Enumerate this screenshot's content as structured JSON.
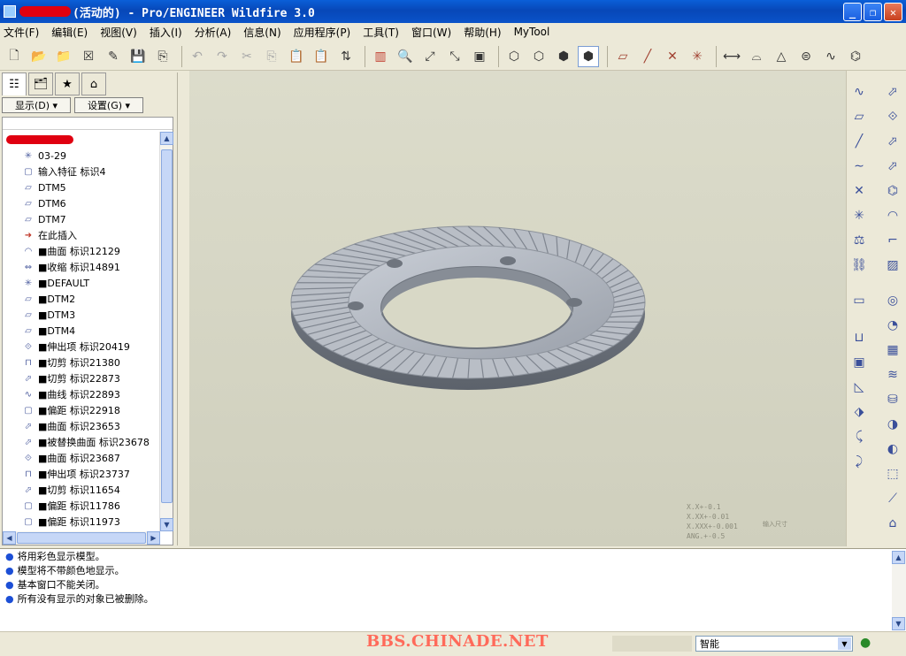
{
  "window": {
    "title": "(活动的) - Pro/ENGINEER Wildfire 3.0",
    "buttons": [
      "_",
      "❐",
      "✕"
    ]
  },
  "menu": [
    "文件(F)",
    "编辑(E)",
    "视图(V)",
    "插入(I)",
    "分析(A)",
    "信息(N)",
    "应用程序(P)",
    "工具(T)",
    "窗口(W)",
    "帮助(H)",
    "MyTool"
  ],
  "left_panel": {
    "display_button": "显示(D) ▾",
    "settings_button": "设置(G) ▾",
    "tree_items": [
      {
        "icon": "csys-icon",
        "glyph": "✳",
        "label": "03-29"
      },
      {
        "icon": "import-feature-icon",
        "glyph": "▢",
        "label": "输入特征 标识4"
      },
      {
        "icon": "datum-plane-icon",
        "glyph": "▱",
        "label": "DTM5"
      },
      {
        "icon": "datum-plane-icon",
        "glyph": "▱",
        "label": "DTM6"
      },
      {
        "icon": "datum-plane-icon",
        "glyph": "▱",
        "label": "DTM7"
      },
      {
        "icon": "insert-here-arrow-icon",
        "glyph": "➜",
        "label": "在此插入"
      },
      {
        "icon": "surface-icon",
        "glyph": "◠",
        "label": "■曲面 标识12129"
      },
      {
        "icon": "shrink-icon",
        "glyph": "⇔",
        "label": "■收缩 标识14891"
      },
      {
        "icon": "csys-icon",
        "glyph": "✳",
        "label": "■DEFAULT"
      },
      {
        "icon": "datum-plane-icon",
        "glyph": "▱",
        "label": "■DTM2"
      },
      {
        "icon": "datum-plane-icon",
        "glyph": "▱",
        "label": "■DTM3"
      },
      {
        "icon": "datum-plane-icon",
        "glyph": "▱",
        "label": "■DTM4"
      },
      {
        "icon": "extrude-icon",
        "glyph": "⟐",
        "label": "■伸出项 标识20419"
      },
      {
        "icon": "cut-icon",
        "glyph": "⊓",
        "label": "■切剪 标识21380"
      },
      {
        "icon": "cut-icon",
        "glyph": "⬀",
        "label": "■切剪 标识22873"
      },
      {
        "icon": "curve-icon",
        "glyph": "∿",
        "label": "■曲线 标识22893"
      },
      {
        "icon": "offset-icon",
        "glyph": "▢",
        "label": "■偏距 标识22918"
      },
      {
        "icon": "surface-icon",
        "glyph": "⬀",
        "label": "■曲面 标识23653"
      },
      {
        "icon": "replaced-surface-icon",
        "glyph": "⬀",
        "label": "■被替换曲面 标识23678"
      },
      {
        "icon": "surface-icon",
        "glyph": "⟐",
        "label": "■曲面 标识23687"
      },
      {
        "icon": "extrude-icon",
        "glyph": "⊓",
        "label": "■伸出项 标识23737"
      },
      {
        "icon": "cut-icon",
        "glyph": "⬀",
        "label": "■切剪 标识11654"
      },
      {
        "icon": "offset-icon",
        "glyph": "▢",
        "label": "■偏距 标识11786"
      },
      {
        "icon": "offset-icon",
        "glyph": "▢",
        "label": "■偏距 标识11973"
      }
    ]
  },
  "graphics": {
    "tolerance": [
      "X.X+-0.1",
      "X.XX+-0.01",
      "X.XXX+-0.001",
      "ANG.+-0.5"
    ],
    "tolerance_note": "输入尺寸"
  },
  "messages": [
    "将用彩色显示模型。",
    "模型将不带颜色地显示。",
    "基本窗口不能关闭。",
    "所有没有显示的对象已被删除。"
  ],
  "status": {
    "watermark": "BBS.CHINADE.NET",
    "filter_value": "智能"
  },
  "colors": {
    "titlebar": "#0747b8",
    "background_top": "#dcdccb",
    "gear": "#a7acb4",
    "watermark": "#ff6a5a"
  }
}
